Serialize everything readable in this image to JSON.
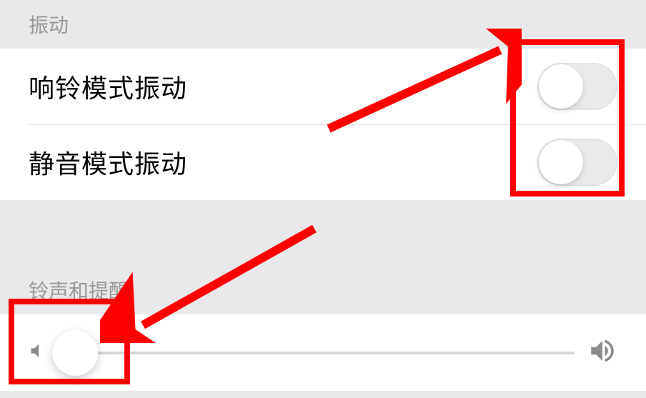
{
  "sections": {
    "vibration": {
      "header": "振动",
      "items": [
        {
          "label": "响铃模式振动",
          "on": false
        },
        {
          "label": "静音模式振动",
          "on": false
        }
      ]
    },
    "ringtone": {
      "header": "铃声和提醒",
      "slider_value": 0
    }
  }
}
